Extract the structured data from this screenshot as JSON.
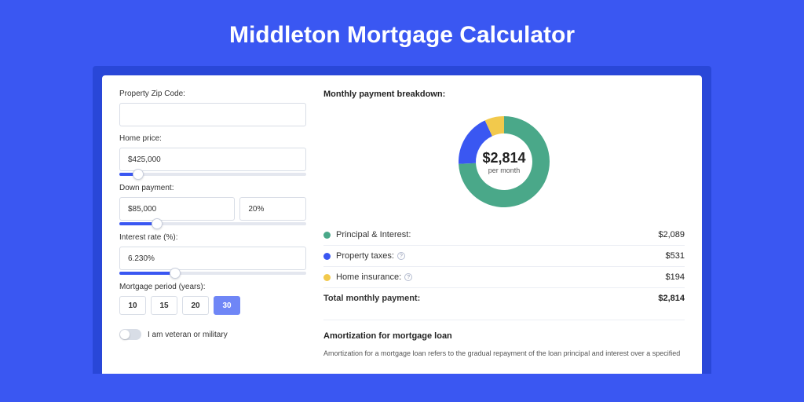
{
  "title": "Middleton Mortgage Calculator",
  "form": {
    "zip": {
      "label": "Property Zip Code:",
      "value": ""
    },
    "home_price": {
      "label": "Home price:",
      "value": "$425,000",
      "slider_pct": 10
    },
    "down_payment": {
      "label": "Down payment:",
      "amount": "$85,000",
      "percent": "20%",
      "slider_pct": 20
    },
    "interest_rate": {
      "label": "Interest rate (%):",
      "value": "6.230%",
      "slider_pct": 30
    },
    "mortgage_period": {
      "label": "Mortgage period (years):",
      "options": [
        "10",
        "15",
        "20",
        "30"
      ],
      "selected": "30"
    },
    "veteran": {
      "label": "I am veteran or military",
      "on": false
    }
  },
  "breakdown": {
    "heading": "Monthly payment breakdown:",
    "center_amount": "$2,814",
    "center_sub": "per month",
    "legend": [
      {
        "color": "#4aa889",
        "label": "Principal & Interest:",
        "amount": "$2,089",
        "info": false
      },
      {
        "color": "#3a57f2",
        "label": "Property taxes:",
        "amount": "$531",
        "info": true
      },
      {
        "color": "#f2c94c",
        "label": "Home insurance:",
        "amount": "$194",
        "info": true
      }
    ],
    "total": {
      "label": "Total monthly payment:",
      "amount": "$2,814"
    }
  },
  "amortization": {
    "heading": "Amortization for mortgage loan",
    "text": "Amortization for a mortgage loan refers to the gradual repayment of the loan principal and interest over a specified"
  },
  "chart_data": {
    "type": "pie",
    "title": "Monthly payment breakdown",
    "series": [
      {
        "name": "Principal & Interest",
        "value": 2089,
        "color": "#4aa889"
      },
      {
        "name": "Property taxes",
        "value": 531,
        "color": "#3a57f2"
      },
      {
        "name": "Home insurance",
        "value": 194,
        "color": "#f2c94c"
      }
    ],
    "total": 2814
  }
}
